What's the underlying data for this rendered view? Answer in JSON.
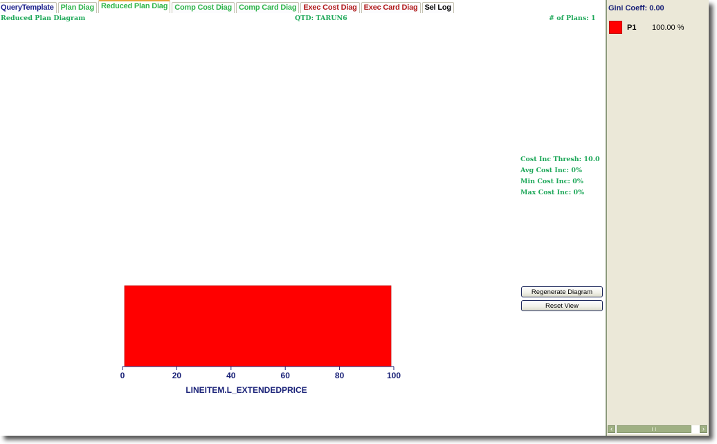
{
  "tabs": [
    {
      "label": "QueryTemplate",
      "color": "#1a1f8a",
      "active": false
    },
    {
      "label": "Plan Diag",
      "color": "#2fb54a",
      "active": false
    },
    {
      "label": "Reduced Plan Diag",
      "color": "#2fb54a",
      "active": true
    },
    {
      "label": "Comp Cost Diag",
      "color": "#2fb54a",
      "active": false
    },
    {
      "label": "Comp Card Diag",
      "color": "#2fb54a",
      "active": false
    },
    {
      "label": "Exec Cost Diag",
      "color": "#b01818",
      "active": false
    },
    {
      "label": "Exec Card Diag",
      "color": "#b01818",
      "active": false
    },
    {
      "label": "Sel Log",
      "color": "#000000",
      "active": false
    }
  ],
  "header": {
    "diagram_title": "Reduced Plan Diagram",
    "qtd": "QTD: TARUN6",
    "num_plans": "# of Plans: 1"
  },
  "stats": {
    "cost_inc_thresh": "Cost Inc Thresh: 10.0",
    "avg_cost_inc": "Avg Cost Inc: 0%",
    "min_cost_inc": "Min Cost Inc: 0%",
    "max_cost_inc": "Max Cost Inc: 0%"
  },
  "buttons": {
    "regenerate": "Regenerate Diagram",
    "reset_view": "Reset View"
  },
  "legend": {
    "gini": "Gini Coeff: 0.00",
    "items": [
      {
        "name": "P1",
        "percent": "100.00 %",
        "color": "#ff0000"
      }
    ]
  },
  "scrollbar": {
    "left_arrow": "‹",
    "right_arrow": "›"
  },
  "chart_data": {
    "type": "bar",
    "title": "Reduced Plan Diagram",
    "xlabel": "LINEITEM.L_EXTENDEDPRICE",
    "ylabel": "",
    "xlim": [
      0,
      100
    ],
    "xticks": [
      0,
      20,
      40,
      60,
      80,
      100
    ],
    "tick_labels": [
      "0",
      "20",
      "40",
      "60",
      "80",
      "100"
    ],
    "regions": [
      {
        "plan": "P1",
        "x_start": 1,
        "x_end": 99,
        "color": "#ff0000"
      }
    ],
    "axis_color": "#1a2278",
    "grid": false
  }
}
